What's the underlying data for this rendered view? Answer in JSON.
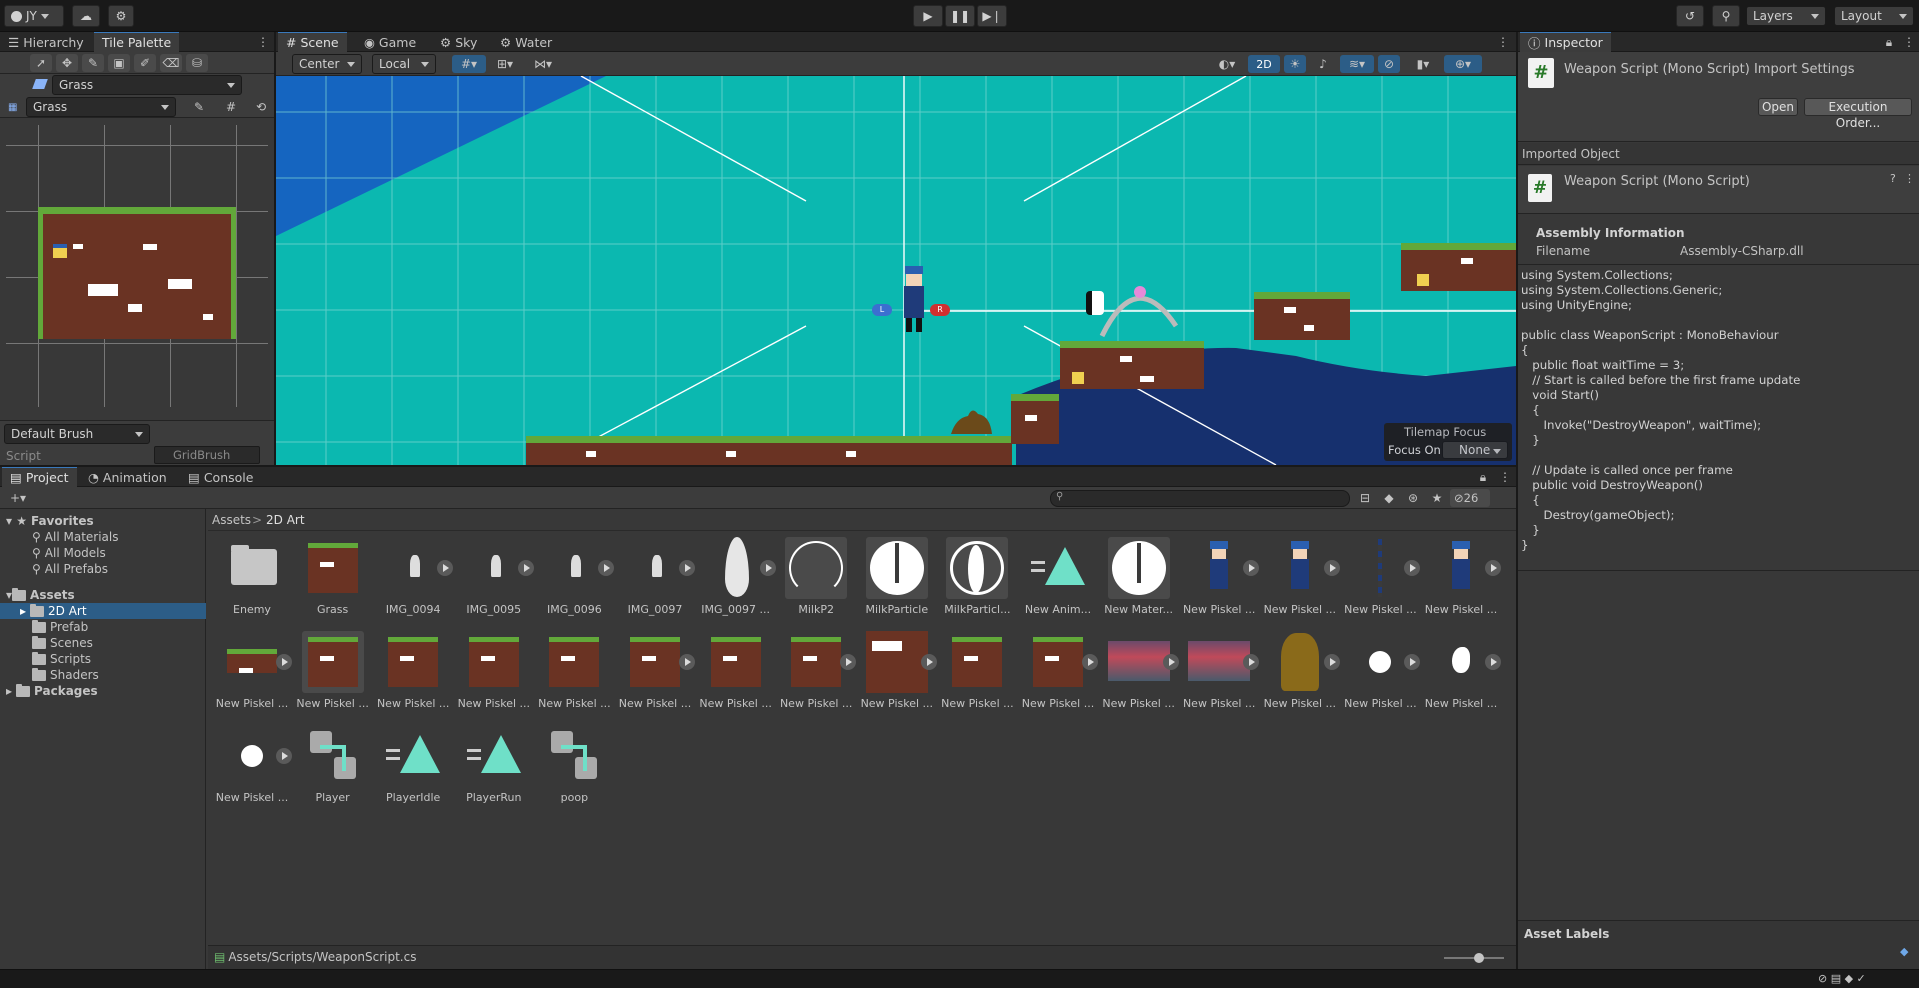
{
  "topbar": {
    "account": "JY",
    "layers": "Layers",
    "layout": "Layout"
  },
  "left_panel": {
    "tabs": [
      "Hierarchy",
      "Tile Palette"
    ],
    "active_tilemap": "Grass",
    "palette": "Grass",
    "brush": "Default Brush",
    "script_label": "Script",
    "script_value": "GridBrush"
  },
  "scene": {
    "tabs": [
      "Scene",
      "Game",
      "Sky",
      "Water"
    ],
    "pivot": "Center",
    "space": "Local",
    "mode_2d": "2D",
    "tilemap_focus_title": "Tilemap Focus",
    "focus_on_label": "Focus On",
    "focus_on_value": "None",
    "label_left": "L",
    "label_right": "R"
  },
  "inspector": {
    "tab": "Inspector",
    "title": "Weapon Script (Mono Script) Import Settings",
    "open_button": "Open",
    "execution_order_button": "Execution Order...",
    "imported_object_header": "Imported Object",
    "object_name": "Weapon Script (Mono Script)",
    "assembly_header": "Assembly Information",
    "filename_label": "Filename",
    "filename_value": "Assembly-CSharp.dll",
    "code_lines": [
      "using System.Collections;",
      "using System.Collections.Generic;",
      "using UnityEngine;",
      "",
      "public class WeaponScript : MonoBehaviour",
      "{",
      "   public float waitTime = 3;",
      "   // Start is called before the first frame update",
      "   void Start()",
      "   {",
      "      Invoke(\"DestroyWeapon\", waitTime);",
      "   }",
      "",
      "   // Update is called once per frame",
      "   public void DestroyWeapon()",
      "   {",
      "      Destroy(gameObject);",
      "   }",
      "}"
    ],
    "asset_labels": "Asset Labels"
  },
  "project": {
    "tabs": [
      "Project",
      "Animation",
      "Console"
    ],
    "hidden_count": "26",
    "favorites": {
      "title": "Favorites",
      "items": [
        "All Materials",
        "All Models",
        "All Prefabs"
      ]
    },
    "assets": {
      "title": "Assets",
      "items": [
        "2D Art",
        "Prefab",
        "Scenes",
        "Scripts",
        "Shaders"
      ]
    },
    "packages": "Packages",
    "breadcrumb": [
      "Assets",
      "2D Art"
    ],
    "path": "Assets/Scripts/WeaponScript.cs",
    "row1": [
      "Enemy",
      "Grass",
      "IMG_0094",
      "IMG_0095",
      "IMG_0096",
      "IMG_0097",
      "IMG_0097 ...",
      "MilkP2",
      "MilkParticle",
      "MilkParticl...",
      "New Anim...",
      "New Mater...",
      "New Piskel ...",
      "New Piskel ...",
      "New Piskel ...",
      "New Piskel ..."
    ],
    "row2": [
      "New Piskel ...",
      "New Piskel ...",
      "New Piskel ...",
      "New Piskel ...",
      "New Piskel ...",
      "New Piskel ...",
      "New Piskel ...",
      "New Piskel ...",
      "New Piskel ...",
      "New Piskel ...",
      "New Piskel ...",
      "New Piskel ...",
      "New Piskel ...",
      "New Piskel ...",
      "New Piskel ...",
      "New Piskel ..."
    ],
    "row3": [
      "New Piskel ...",
      "Player",
      "PlayerIdle",
      "PlayerRun",
      "poop"
    ]
  },
  "colors": {
    "accent": "#3a79bb",
    "scene_bg": "#0bb8b0",
    "selection": "#2c5d87"
  }
}
